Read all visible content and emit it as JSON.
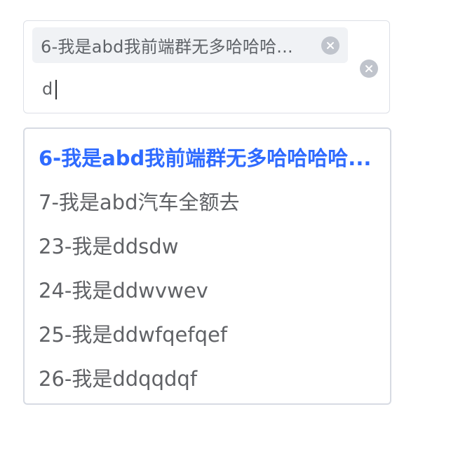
{
  "select": {
    "selected_tag": "6-我是abd我前端群无多哈哈哈...",
    "search_value": "d"
  },
  "dropdown": {
    "options": [
      {
        "label": "6-我是abd我前端群无多哈哈哈哈...",
        "selected": true
      },
      {
        "label": "7-我是abd汽车全额去",
        "selected": false
      },
      {
        "label": "23-我是ddsdw",
        "selected": false
      },
      {
        "label": "24-我是ddwvwev",
        "selected": false
      },
      {
        "label": "25-我是ddwfqefqef",
        "selected": false
      },
      {
        "label": "26-我是ddqqdqf",
        "selected": false
      }
    ]
  },
  "colors": {
    "accent": "#2f6bff",
    "tag_bg": "#f0f2f5",
    "close_bg": "#c0c4cc",
    "text": "#606266",
    "border": "#d7dbe3"
  },
  "icons": {
    "tag_close": "close-circle-icon",
    "clear_all": "close-circle-icon"
  }
}
